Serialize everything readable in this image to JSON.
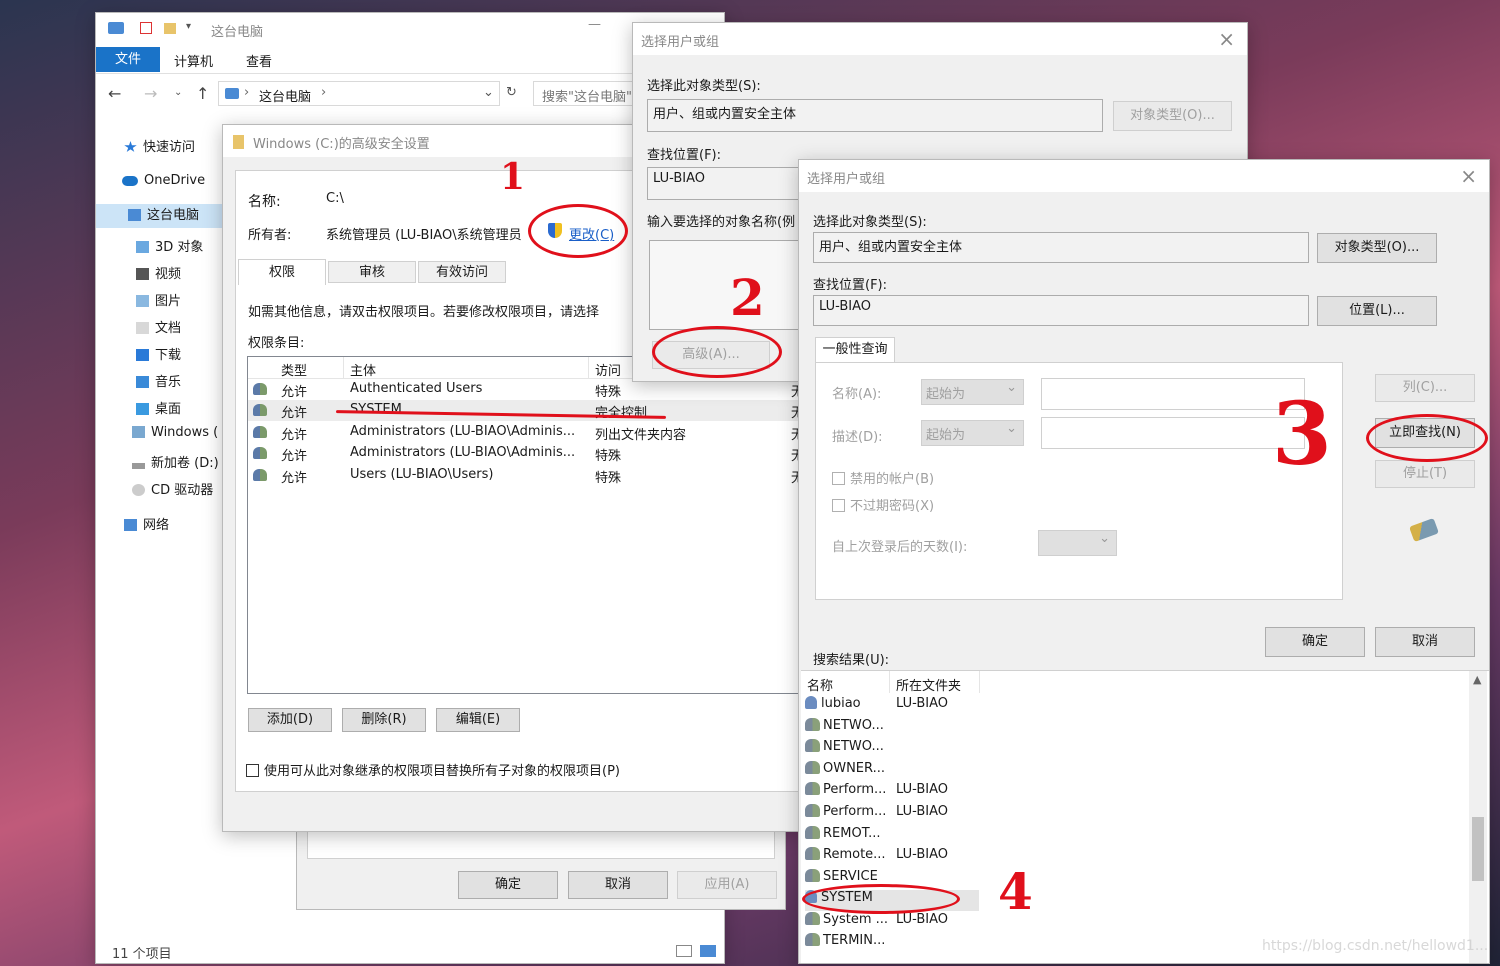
{
  "explorer": {
    "title": "这台电脑",
    "ribbon_tabs": [
      "文件",
      "计算机",
      "查看"
    ],
    "address": "这台电脑",
    "search_placeholder": "搜索\"这台电脑\"",
    "nav": [
      "快速访问",
      "OneDrive",
      "这台电脑",
      "3D 对象",
      "视频",
      "图片",
      "文档",
      "下载",
      "音乐",
      "桌面",
      "Windows (",
      "新加卷 (D:)",
      "CD 驱动器",
      "网络"
    ],
    "status": "11 个项目"
  },
  "adv": {
    "title": "Windows (C:)的高级安全设置",
    "name_label": "名称:",
    "name_value": "C:\\",
    "owner_label": "所有者:",
    "owner_value": "系统管理员 (LU-BIAO\\系统管理员",
    "change_link": "更改(C)",
    "tabs": [
      "权限",
      "审核",
      "有效访问"
    ],
    "info": "如需其他信息，请双击权限项目。若要修改权限项目，请选择",
    "entries_label": "权限条目:",
    "columns": [
      "类型",
      "主体",
      "访问"
    ],
    "rows": [
      {
        "type": "允许",
        "principal": "Authenticated Users",
        "access": "特殊",
        "suffix": "无"
      },
      {
        "type": "允许",
        "principal": "SYSTEM",
        "access": "完全控制",
        "suffix": "无"
      },
      {
        "type": "允许",
        "principal": "Administrators (LU-BIAO\\Adminis...",
        "access": "列出文件夹内容",
        "suffix": "无"
      },
      {
        "type": "允许",
        "principal": "Administrators (LU-BIAO\\Adminis...",
        "access": "特殊",
        "suffix": "无"
      },
      {
        "type": "允许",
        "principal": "Users (LU-BIAO\\Users)",
        "access": "特殊",
        "suffix": "无"
      }
    ],
    "add": "添加(D)",
    "remove": "删除(R)",
    "edit": "编辑(E)",
    "replace_checkbox": "使用可从此对象继承的权限项目替换所有子对象的权限项目(P)"
  },
  "props_buttons": {
    "ok": "确定",
    "cancel": "取消",
    "apply": "应用(A)"
  },
  "sel1": {
    "title": "选择用户或组",
    "obj_type_label": "选择此对象类型(S):",
    "obj_type_value": "用户、组或内置安全主体",
    "obj_type_btn": "对象类型(O)...",
    "location_label": "查找位置(F):",
    "location_value": "LU-BIAO",
    "enter_label": "输入要选择的对象名称(例",
    "advanced_btn": "高级(A)..."
  },
  "sel2": {
    "title": "选择用户或组",
    "obj_type_label": "选择此对象类型(S):",
    "obj_type_value": "用户、组或内置安全主体",
    "obj_type_btn": "对象类型(O)...",
    "location_label": "查找位置(F):",
    "location_value": "LU-BIAO",
    "location_btn": "位置(L)...",
    "tab": "一般性查询",
    "name_label": "名称(A):",
    "desc_label": "描述(D):",
    "starts_with": "起始为",
    "disabled_accounts": "禁用的帐户(B)",
    "nonexpiring": "不过期密码(X)",
    "days_label": "自上次登录后的天数(I):",
    "columns_btn": "列(C)...",
    "find_now_btn": "立即查找(N)",
    "stop_btn": "停止(T)",
    "ok": "确定",
    "cancel": "取消",
    "results_label": "搜索结果(U):",
    "results_cols": [
      "名称",
      "所在文件夹"
    ],
    "results": [
      {
        "name": "lubiao",
        "folder": "LU-BIAO",
        "kind": "user"
      },
      {
        "name": "NETWO...",
        "folder": "",
        "kind": "group"
      },
      {
        "name": "NETWO...",
        "folder": "",
        "kind": "group"
      },
      {
        "name": "OWNER...",
        "folder": "",
        "kind": "group"
      },
      {
        "name": "Perform...",
        "folder": "LU-BIAO",
        "kind": "group"
      },
      {
        "name": "Perform...",
        "folder": "LU-BIAO",
        "kind": "group"
      },
      {
        "name": "REMOT...",
        "folder": "",
        "kind": "group"
      },
      {
        "name": "Remote...",
        "folder": "LU-BIAO",
        "kind": "group"
      },
      {
        "name": "SERVICE",
        "folder": "",
        "kind": "group"
      },
      {
        "name": "SYSTEM",
        "folder": "",
        "kind": "user"
      },
      {
        "name": "System ...",
        "folder": "LU-BIAO",
        "kind": "group"
      },
      {
        "name": "TERMIN...",
        "folder": "",
        "kind": "group"
      }
    ]
  },
  "annotations": [
    "1",
    "2",
    "3",
    "4"
  ],
  "watermark": "https://blog.csdn.net/hellowd1..."
}
